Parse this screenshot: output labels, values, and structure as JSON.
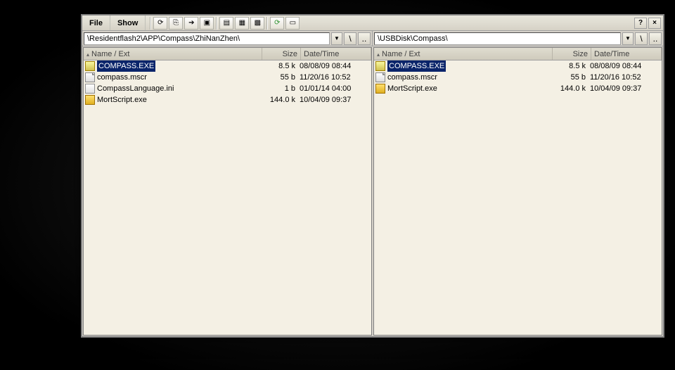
{
  "menu": {
    "file": "File",
    "show": "Show"
  },
  "toolbar_icons": [
    "refresh-left-icon",
    "copy-icon",
    "move-icon",
    "new-folder-icon",
    "view-list-icon",
    "view-details-icon",
    "tile-icon",
    "refresh-icon",
    "mark-icon"
  ],
  "sysbuttons": {
    "help": "?",
    "close": "×"
  },
  "left": {
    "path": "\\Residentflash2\\APP\\Compass\\ZhiNanZhen\\",
    "up_label": "\\",
    "updir_label": "..",
    "columns": {
      "name": "Name / Ext",
      "size": "Size",
      "date": "Date/Time"
    },
    "files": [
      {
        "name": "COMPASS.EXE",
        "size": "8.5 k",
        "date": "08/08/09 08:44",
        "icon": "exe",
        "selected": true
      },
      {
        "name": "compass.mscr",
        "size": "55 b",
        "date": "11/20/16 10:52",
        "icon": "file",
        "selected": false
      },
      {
        "name": "CompassLanguage.ini",
        "size": "1 b",
        "date": "01/01/14 04:00",
        "icon": "ini",
        "selected": false
      },
      {
        "name": "MortScript.exe",
        "size": "144.0 k",
        "date": "10/04/09 09:37",
        "icon": "mort",
        "selected": false
      }
    ]
  },
  "right": {
    "path": "\\USBDisk\\Compass\\",
    "up_label": "\\",
    "updir_label": "..",
    "columns": {
      "name": "Name / Ext",
      "size": "Size",
      "date": "Date/Time"
    },
    "files": [
      {
        "name": "COMPASS.EXE",
        "size": "8.5 k",
        "date": "08/08/09 08:44",
        "icon": "exe",
        "selected": true
      },
      {
        "name": "compass.mscr",
        "size": "55 b",
        "date": "11/20/16 10:52",
        "icon": "file",
        "selected": false
      },
      {
        "name": "MortScript.exe",
        "size": "144.0 k",
        "date": "10/04/09 09:37",
        "icon": "mort",
        "selected": false
      }
    ]
  },
  "sort_indicator": "▴"
}
